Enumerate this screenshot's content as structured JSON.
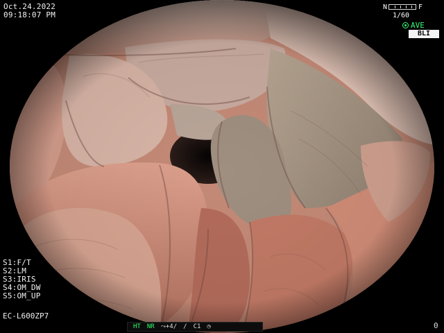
{
  "overlay": {
    "date": "Oct.24.2022",
    "time": "09:18:07  PM",
    "shutter_start": "N",
    "shutter_end": "F",
    "exposure": "1/60",
    "ave": "AVE",
    "bli": "BLI",
    "presets": [
      "S1:F/T",
      "S2:LM",
      "S3:IRIS",
      "S4:OM_DW",
      "S5:OM_UP"
    ],
    "model": "EC-L600ZP7"
  },
  "statusbar": {
    "ht": "HT",
    "nr": "NR",
    "enhance": "+4/",
    "slash": "/",
    "c1": "C1",
    "icon": "clock-icon"
  },
  "counter": "0",
  "colors": {
    "green": "#35ff74",
    "tissue": "#c78a76"
  }
}
